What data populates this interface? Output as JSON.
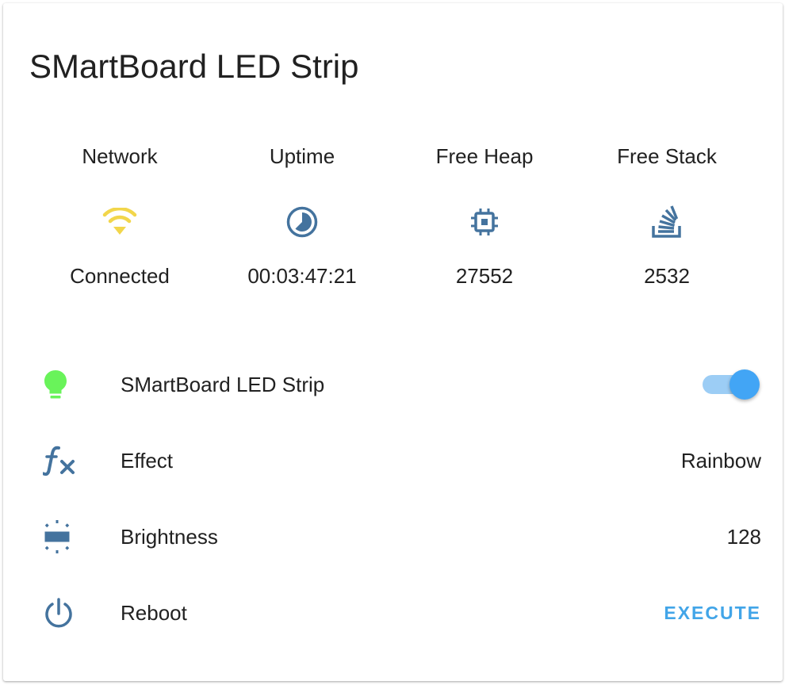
{
  "card": {
    "title": "SMartBoard LED Strip"
  },
  "glance": [
    {
      "name": "Network",
      "icon": "wifi-icon",
      "state": "Connected",
      "icon_color": "#f2d64b"
    },
    {
      "name": "Uptime",
      "icon": "clock-icon",
      "state": "00:03:47:21",
      "icon_color": "#44739e"
    },
    {
      "name": "Free Heap",
      "icon": "chip-icon",
      "state": "27552",
      "icon_color": "#44739e"
    },
    {
      "name": "Free Stack",
      "icon": "stack-overflow-icon",
      "state": "2532",
      "icon_color": "#44739e"
    }
  ],
  "entities": {
    "light": {
      "label": "SMartBoard LED Strip",
      "icon": "lightbulb-icon",
      "icon_color": "#69f35a",
      "state": "on"
    },
    "effect": {
      "label": "Effect",
      "icon": "function-icon",
      "value": "Rainbow"
    },
    "brightness": {
      "label": "Brightness",
      "icon": "brightness-icon",
      "value": "128"
    },
    "reboot": {
      "label": "Reboot",
      "icon": "power-icon",
      "action": "EXECUTE"
    }
  },
  "colors": {
    "icon_default": "#44739e",
    "accent": "#42a5f5",
    "text": "#212121"
  }
}
